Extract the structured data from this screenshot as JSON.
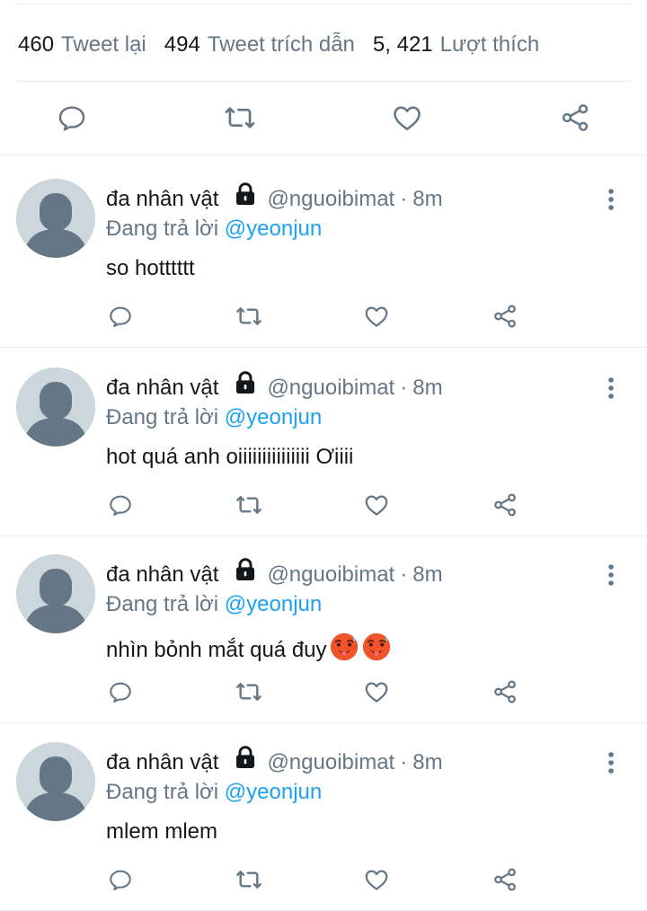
{
  "stats": {
    "retweets_count": "460",
    "retweets_label": "Tweet lại",
    "quotes_count": "494",
    "quotes_label": "Tweet trích dẫn",
    "likes_count": "5, 421",
    "likes_label": "Lượt thích"
  },
  "icons": {
    "reply": "reply-icon",
    "retweet": "retweet-icon",
    "like": "heart-icon",
    "share": "share-icon",
    "lock": "lock-icon",
    "more": "more-icon",
    "emoji": "hot-face-emoji"
  },
  "colors": {
    "icon_gray": "#657786",
    "mention_blue": "#1da1f2",
    "avatar_bg": "#ccd6dd",
    "avatar_fg": "#657786",
    "divider": "#e6ecf0"
  },
  "replies": [
    {
      "name": "đa nhân vật",
      "handle": "@nguoibimat",
      "separator": "·",
      "time": "8m",
      "replying_prefix": "Đang trả lời",
      "replying_to": "@yeonjun",
      "text": "so hotttttt"
    },
    {
      "name": "đa nhân vật",
      "handle": "@nguoibimat",
      "separator": "·",
      "time": "8m",
      "replying_prefix": "Đang trả lời",
      "replying_to": "@yeonjun",
      "text": "hot quá anh oiiiiiiiiiiiiiii Ơiiii"
    },
    {
      "name": "đa nhân vật",
      "handle": "@nguoibimat",
      "separator": "·",
      "time": "8m",
      "replying_prefix": "Đang trả lời",
      "replying_to": "@yeonjun",
      "text": "nhìn bỏnh mắt quá đuy"
    },
    {
      "name": "đa nhân vật",
      "handle": "@nguoibimat",
      "separator": "·",
      "time": "8m",
      "replying_prefix": "Đang trả lời",
      "replying_to": "@yeonjun",
      "text": "mlem mlem"
    }
  ]
}
